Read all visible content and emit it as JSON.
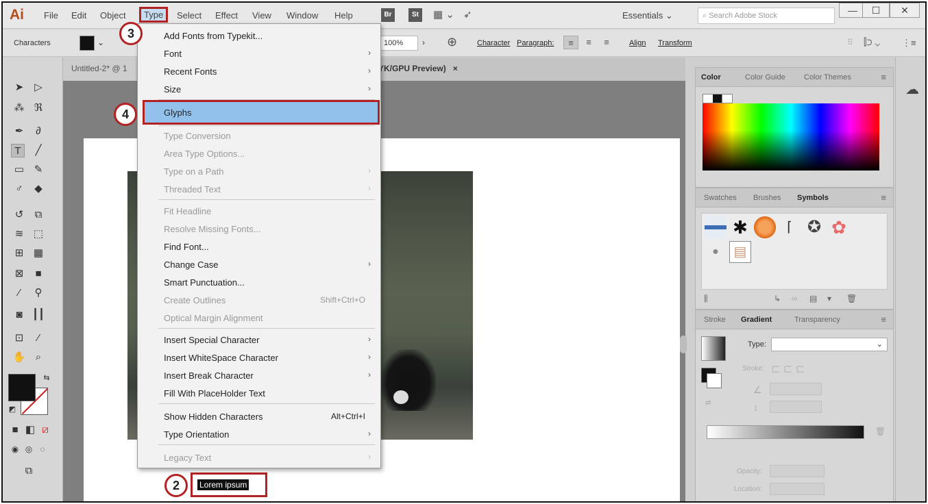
{
  "menubar": {
    "logo": "Ai",
    "items": [
      "File",
      "Edit",
      "Object",
      "Type",
      "Select",
      "Effect",
      "View",
      "Window",
      "Help"
    ],
    "bridge": "Br",
    "stock": "St",
    "workspace": "Essentials",
    "search_placeholder": "Search Adobe Stock"
  },
  "controlbar": {
    "panel_label": "Characters",
    "zoom": "100%",
    "character_link": "Character",
    "paragraph_link": "Paragraph:",
    "align_link": "Align",
    "transform_link": "Transform"
  },
  "document": {
    "tab1": "Untitled-2* @ 1",
    "tab2": "YK/GPU Preview)",
    "tab2_close": "×",
    "selected_text": "Lorem ipsum"
  },
  "type_menu": [
    {
      "label": "Add Fonts from Typekit...",
      "state": "enabled"
    },
    {
      "label": "Font",
      "state": "enabled",
      "submenu": true
    },
    {
      "label": "Recent Fonts",
      "state": "enabled",
      "submenu": true
    },
    {
      "label": "Size",
      "state": "enabled",
      "submenu": true
    },
    {
      "label": "Glyphs",
      "state": "highlighted"
    },
    {
      "label": "Type Conversion",
      "state": "disabled"
    },
    {
      "label": "Area Type Options...",
      "state": "disabled"
    },
    {
      "label": "Type on a Path",
      "state": "disabled",
      "submenu": true
    },
    {
      "label": "Threaded Text",
      "state": "disabled",
      "submenu": true
    },
    {
      "label": "Fit Headline",
      "state": "disabled"
    },
    {
      "label": "Resolve Missing Fonts...",
      "state": "disabled"
    },
    {
      "label": "Find Font...",
      "state": "enabled"
    },
    {
      "label": "Change Case",
      "state": "enabled",
      "submenu": true
    },
    {
      "label": "Smart Punctuation...",
      "state": "enabled"
    },
    {
      "label": "Create Outlines",
      "state": "disabled",
      "shortcut": "Shift+Ctrl+O"
    },
    {
      "label": "Optical Margin Alignment",
      "state": "disabled"
    },
    {
      "label": "Insert Special Character",
      "state": "enabled",
      "submenu": true
    },
    {
      "label": "Insert WhiteSpace Character",
      "state": "enabled",
      "submenu": true
    },
    {
      "label": "Insert Break Character",
      "state": "enabled",
      "submenu": true
    },
    {
      "label": "Fill With PlaceHolder Text",
      "state": "enabled"
    },
    {
      "label": "Show Hidden Characters",
      "state": "enabled",
      "shortcut": "Alt+Ctrl+I"
    },
    {
      "label": "Type Orientation",
      "state": "enabled",
      "submenu": true
    },
    {
      "label": "Legacy Text",
      "state": "disabled",
      "submenu": true
    }
  ],
  "steps": [
    "2",
    "3",
    "4"
  ],
  "panels": {
    "color_tabs": [
      "Color",
      "Color Guide",
      "Color Themes"
    ],
    "swatch_tabs": [
      "Swatches",
      "Brushes",
      "Symbols"
    ],
    "gradient_tabs": [
      "Stroke",
      "Gradient",
      "Transparency"
    ],
    "gradient_type_label": "Type:",
    "stroke_label": "Stroke:",
    "opacity_label": "Opacity:",
    "location_label": "Location:"
  }
}
